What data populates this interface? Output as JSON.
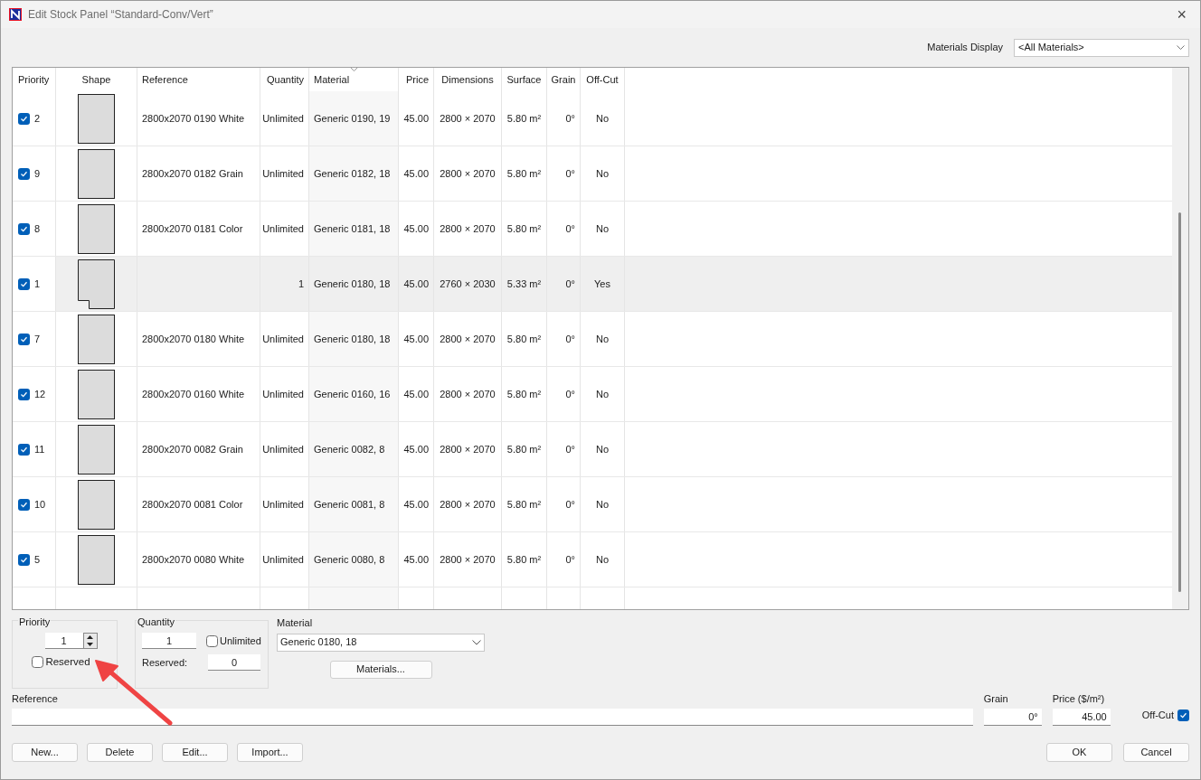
{
  "window": {
    "title": "Edit Stock Panel “Standard-Conv/Vert”",
    "close": "×"
  },
  "materials_display": {
    "label": "Materials Display",
    "value": "<All Materials>"
  },
  "table": {
    "columns": [
      "Priority",
      "Shape",
      "Reference",
      "Quantity",
      "Material",
      "Price",
      "Dimensions",
      "Surface",
      "Grain",
      "Off-Cut"
    ],
    "rows": [
      {
        "checked": true,
        "selected": false,
        "priority": "2",
        "kind": "rect",
        "reference": "2800x2070 0190 White",
        "quantity": "Unlimited",
        "material": "Generic 0190, 19",
        "price": "45.00",
        "dimensions": "2800 × 2070",
        "surface": "5.80 m²",
        "grain": "0°",
        "offcut": "No"
      },
      {
        "checked": true,
        "selected": false,
        "priority": "9",
        "kind": "rect",
        "reference": "2800x2070 0182 Grain",
        "quantity": "Unlimited",
        "material": "Generic 0182, 18",
        "price": "45.00",
        "dimensions": "2800 × 2070",
        "surface": "5.80 m²",
        "grain": "0°",
        "offcut": "No"
      },
      {
        "checked": true,
        "selected": false,
        "priority": "8",
        "kind": "rect",
        "reference": "2800x2070 0181 Color",
        "quantity": "Unlimited",
        "material": "Generic 0181, 18",
        "price": "45.00",
        "dimensions": "2800 × 2070",
        "surface": "5.80 m²",
        "grain": "0°",
        "offcut": "No"
      },
      {
        "checked": true,
        "selected": true,
        "priority": "1",
        "kind": "notched",
        "quantity": "1",
        "material": "Generic 0180, 18",
        "price": "45.00",
        "dimensions": "2760 × 2030",
        "surface": "5.33 m²",
        "grain": "0°",
        "offcut": "Yes"
      },
      {
        "checked": true,
        "selected": false,
        "priority": "7",
        "kind": "rect",
        "reference": "2800x2070 0180 White",
        "quantity": "Unlimited",
        "material": "Generic 0180, 18",
        "price": "45.00",
        "dimensions": "2800 × 2070",
        "surface": "5.80 m²",
        "grain": "0°",
        "offcut": "No"
      },
      {
        "checked": true,
        "selected": false,
        "priority": "12",
        "kind": "rect",
        "reference": "2800x2070 0160 White",
        "quantity": "Unlimited",
        "material": "Generic 0160, 16",
        "price": "45.00",
        "dimensions": "2800 × 2070",
        "surface": "5.80 m²",
        "grain": "0°",
        "offcut": "No"
      },
      {
        "checked": true,
        "selected": false,
        "priority": "11",
        "kind": "rect",
        "reference": "2800x2070 0082 Grain",
        "quantity": "Unlimited",
        "material": "Generic 0082, 8",
        "price": "45.00",
        "dimensions": "2800 × 2070",
        "surface": "5.80 m²",
        "grain": "0°",
        "offcut": "No"
      },
      {
        "checked": true,
        "selected": false,
        "priority": "10",
        "kind": "rect",
        "reference": "2800x2070 0081 Color",
        "quantity": "Unlimited",
        "material": "Generic 0081, 8",
        "price": "45.00",
        "dimensions": "2800 × 2070",
        "surface": "5.80 m²",
        "grain": "0°",
        "offcut": "No"
      },
      {
        "checked": true,
        "selected": false,
        "priority": "5",
        "kind": "rect",
        "reference": "2800x2070 0080 White",
        "quantity": "Unlimited",
        "material": "Generic 0080, 8",
        "price": "45.00",
        "dimensions": "2800 × 2070",
        "surface": "5.80 m²",
        "grain": "0°",
        "offcut": "No"
      }
    ]
  },
  "priority_group": {
    "title": "Priority",
    "value": "1",
    "reserved_label": "Reserved",
    "reserved": false
  },
  "quantity_group": {
    "title": "Quantity",
    "value": "1",
    "unlimited_label": "Unlimited",
    "unlimited": false,
    "reserved_label": "Reserved:",
    "reserved_value": "0"
  },
  "material": {
    "label": "Material",
    "value": "Generic 0180, 18",
    "button": "Materials..."
  },
  "reference": {
    "label": "Reference"
  },
  "grain": {
    "label": "Grain",
    "value": "0°"
  },
  "price": {
    "label": "Price ($/m²)",
    "value": "45.00"
  },
  "offcut": {
    "label": "Off-Cut",
    "checked": true
  },
  "buttons_left": [
    "New...",
    "Delete",
    "Edit...",
    "Import..."
  ],
  "buttons_right": [
    "OK",
    "Cancel"
  ]
}
